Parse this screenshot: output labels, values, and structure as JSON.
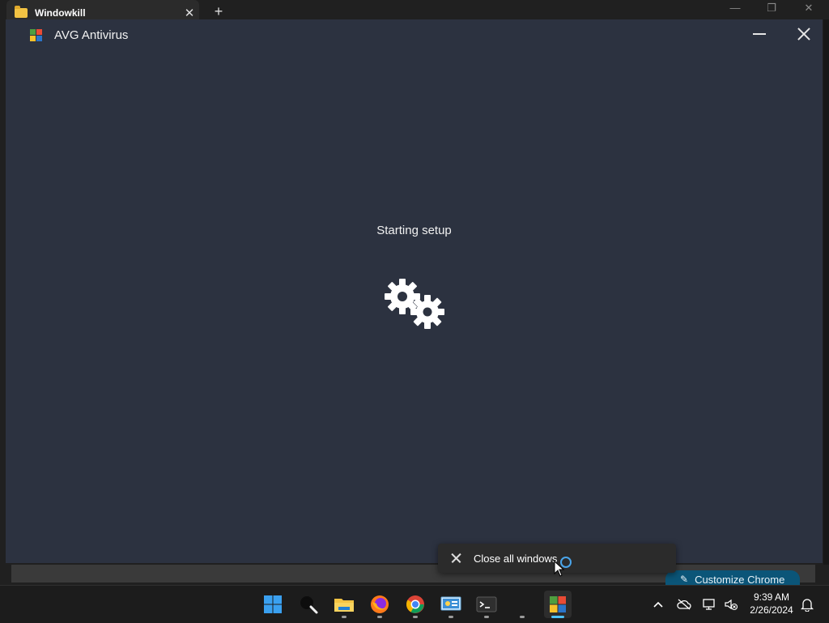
{
  "background_window": {
    "tab_title": "Windowkill",
    "new_tab": "+",
    "tab_close": "✕",
    "controls": {
      "minimize": "—",
      "maximize": "❐",
      "close": "✕"
    }
  },
  "avg_window": {
    "title": "AVG Antivirus",
    "status": "Starting setup",
    "logo_colors": [
      "#4f9e3f",
      "#e94b35",
      "#f6c12b",
      "#2b74c9"
    ]
  },
  "toast": {
    "label": "Close all windows"
  },
  "chrome_button": {
    "label": "Customize Chrome",
    "icon": "✎"
  },
  "taskbar": {
    "icons": [
      {
        "name": "start-icon",
        "active": false
      },
      {
        "name": "search-icon",
        "active": false
      },
      {
        "name": "file-explorer-icon",
        "active": false
      },
      {
        "name": "firefox-icon",
        "active": false
      },
      {
        "name": "chrome-icon",
        "active": false
      },
      {
        "name": "control-panel-icon",
        "active": false
      },
      {
        "name": "terminal-icon",
        "active": false
      },
      {
        "name": "blank-app-icon",
        "active": false
      },
      {
        "name": "avg-icon",
        "active": true
      }
    ],
    "tray": {
      "chevron": "^",
      "time": "9:39 AM",
      "date": "2/26/2024"
    }
  }
}
